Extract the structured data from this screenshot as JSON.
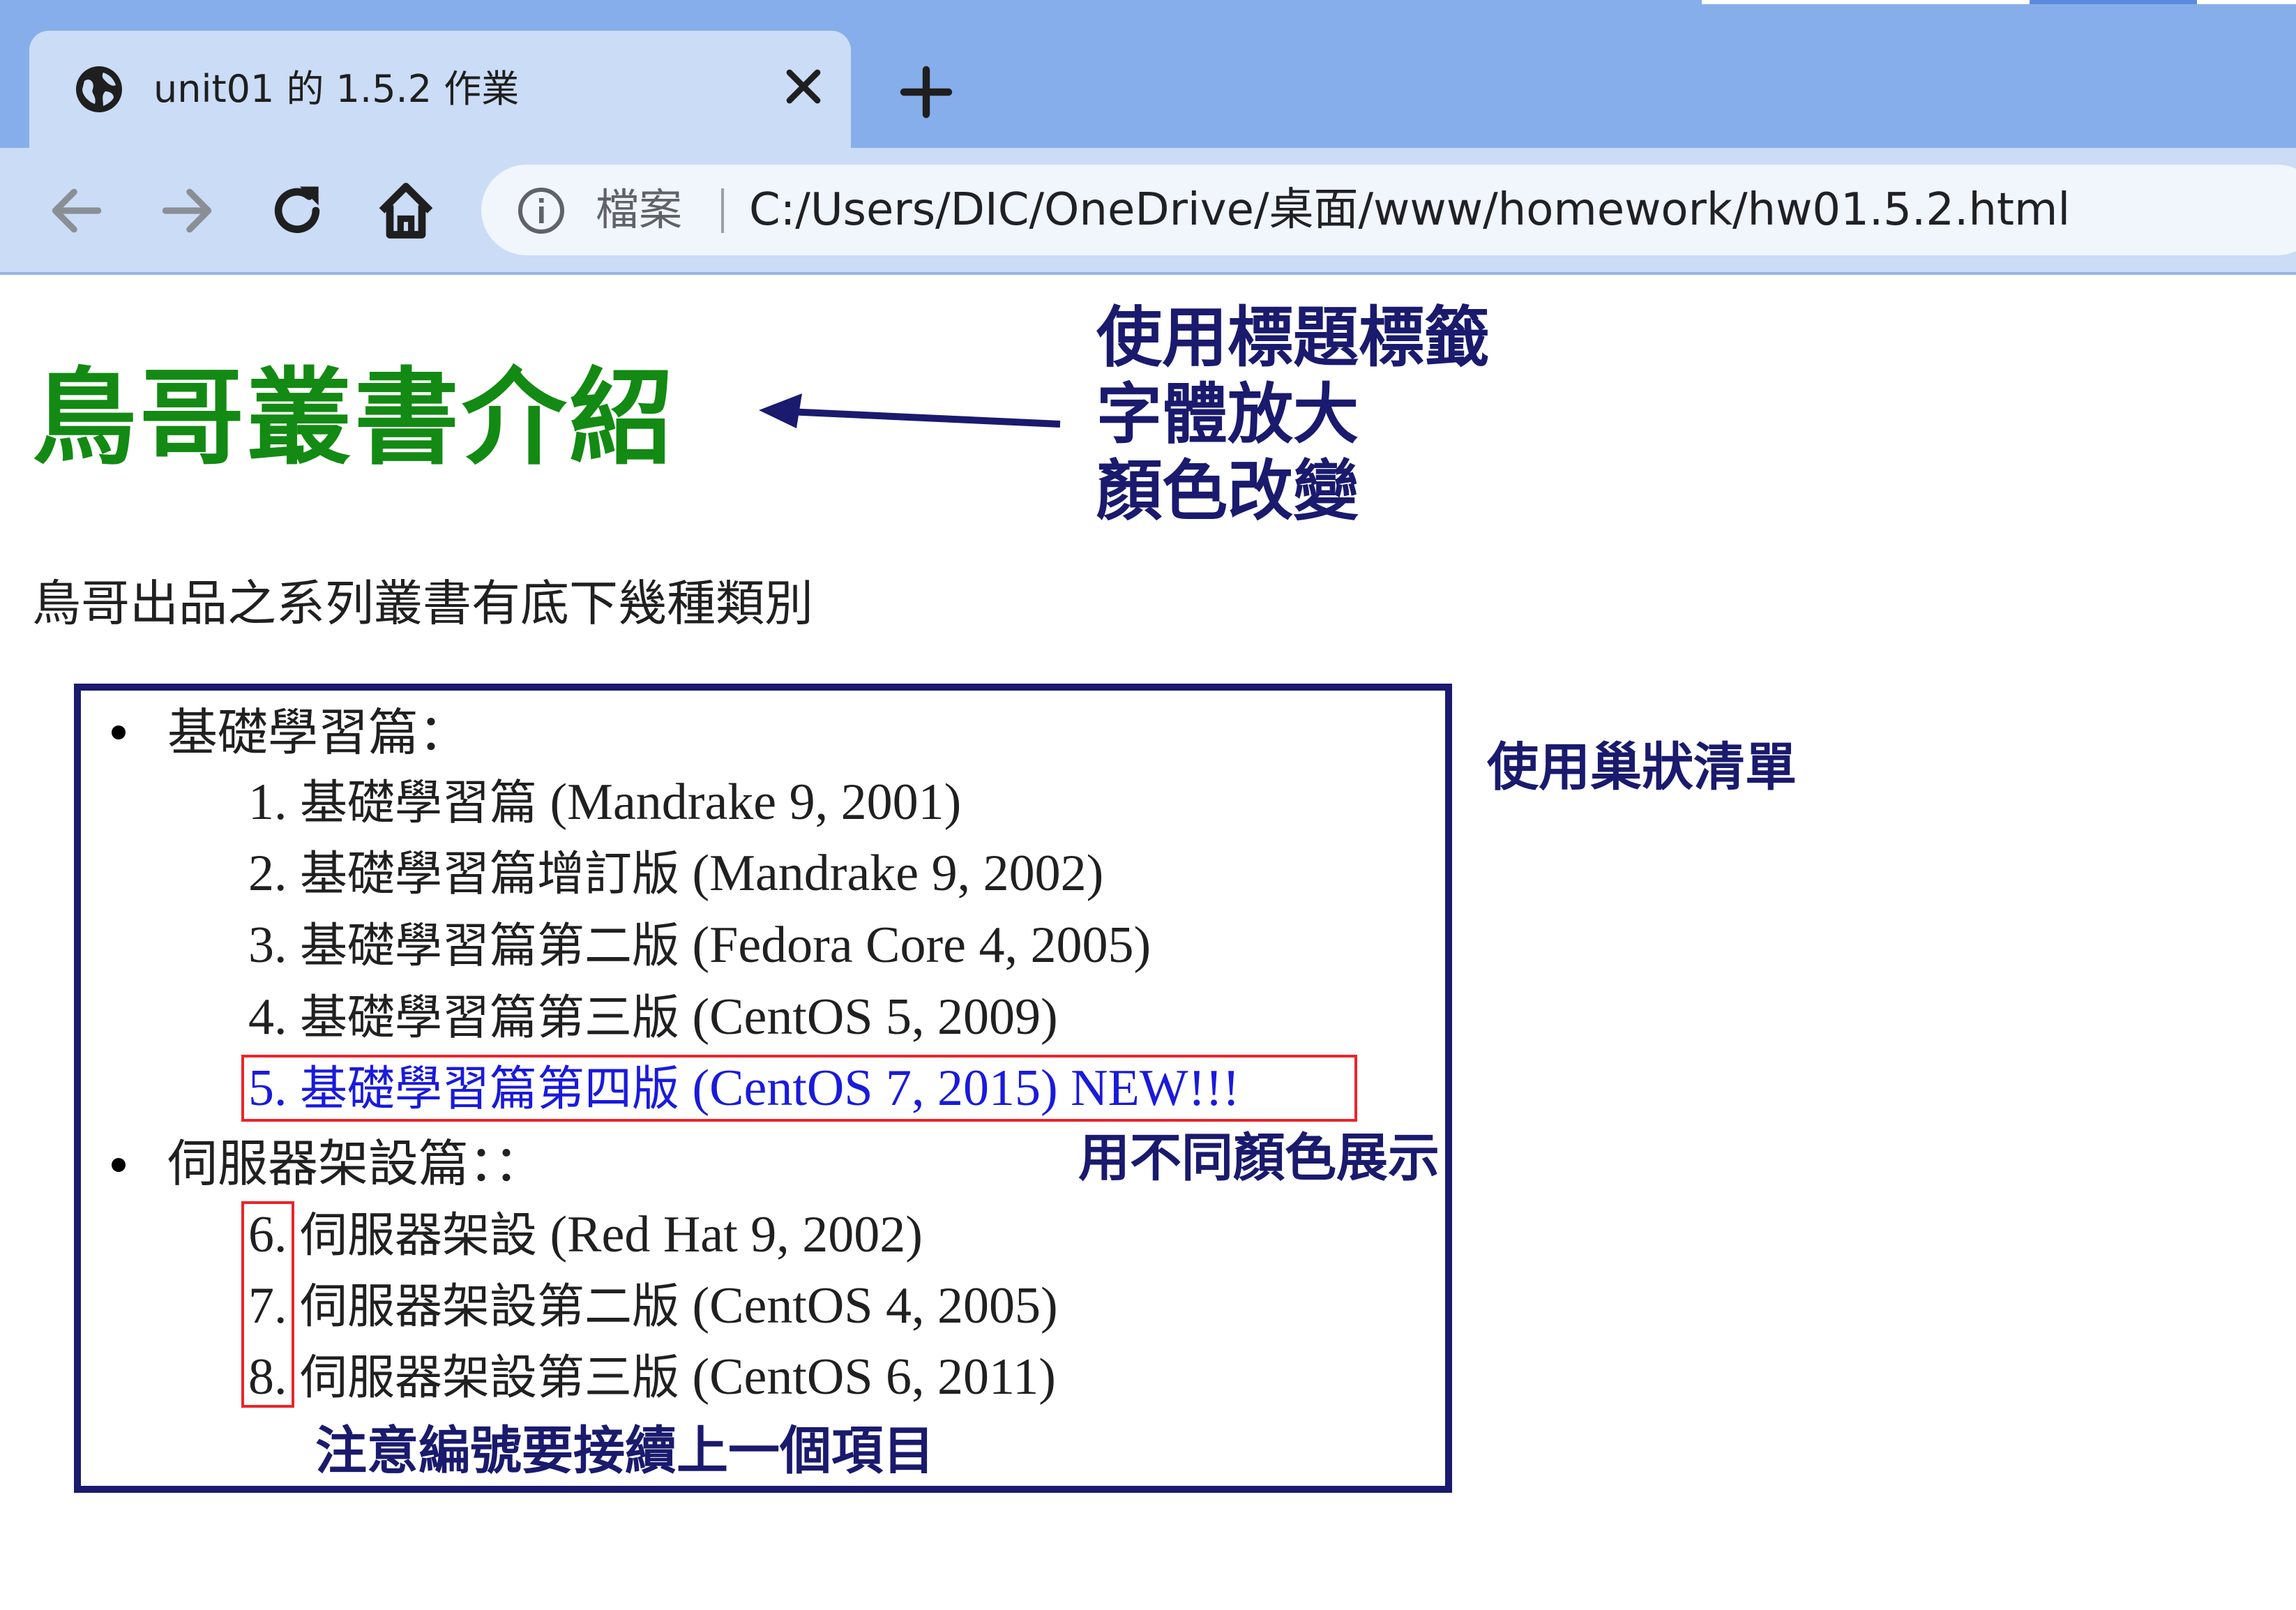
{
  "browser": {
    "tab_title": "unit01 的 1.5.2 作業",
    "address_scheme": "檔案",
    "address_url": "C:/Users/DIC/OneDrive/桌面/www/homework/hw01.5.2.html",
    "icons": [
      "globe-icon",
      "close-icon",
      "new-tab-icon",
      "back-icon",
      "forward-icon",
      "reload-icon",
      "home-icon",
      "info-icon"
    ]
  },
  "page": {
    "heading": "鳥哥叢書介紹",
    "heading_color": "#138a13",
    "intro": "鳥哥出品之系列叢書有底下幾種類別",
    "list": [
      {
        "label": "基礎學習篇：",
        "items": [
          {
            "num": "1.",
            "title": "基礎學習篇",
            "detail": " (Mandrake 9, 2001)"
          },
          {
            "num": "2.",
            "title": "基礎學習篇增訂版",
            "detail": " (Mandrake 9, 2002)"
          },
          {
            "num": "3.",
            "title": "基礎學習篇第二版",
            "detail": " (Fedora Core 4, 2005)"
          },
          {
            "num": "4.",
            "title": "基礎學習篇第三版",
            "detail": " (CentOS 5, 2009)"
          },
          {
            "num": "5.",
            "title": "基礎學習篇第四版",
            "detail": " (CentOS 7, 2015) NEW!!!"
          }
        ]
      },
      {
        "label": "伺服器架設篇：：",
        "items": [
          {
            "num": "6.",
            "title": "伺服器架設",
            "detail": " (Red Hat 9, 2002)"
          },
          {
            "num": "7.",
            "title": "伺服器架設第二版",
            "detail": " (CentOS 4, 2005)"
          },
          {
            "num": "8.",
            "title": "伺服器架設第三版",
            "detail": " (CentOS 6, 2011)"
          }
        ]
      }
    ],
    "new_item_color": "#1a1adb"
  },
  "annotations": {
    "heading_lines": [
      "使用標題標籤",
      "字體放大",
      "顏色改變"
    ],
    "nested_list": "使用巢狀清單",
    "color_note": "用不同顏色展示",
    "numbering_note": "注意編號要接續上一個項目",
    "annotation_color": "#1a1a6e",
    "highlight_color": "#e8262b"
  }
}
